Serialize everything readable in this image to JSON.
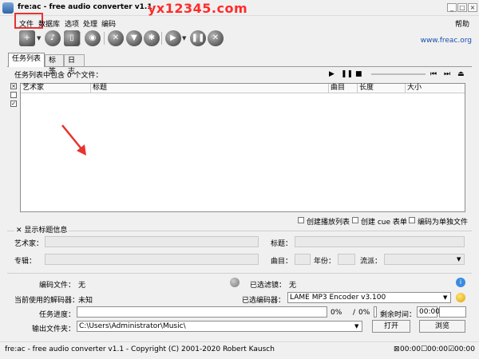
{
  "window": {
    "title": "fre:ac - free audio converter v1.1",
    "watermark": "yx12345.com"
  },
  "menu": {
    "file": "文件",
    "database": "数据库",
    "options": "选项",
    "process": "处理",
    "encode": "编码",
    "help": "帮助"
  },
  "toolbar": {
    "site": "www.freac.org"
  },
  "tabs": [
    "任务列表",
    "标签",
    "日志"
  ],
  "joblist": {
    "info": "任务列表中包含 0 个文件：",
    "columns": {
      "artist": "艺术家",
      "title": "标题",
      "track": "曲目",
      "length": "长度",
      "size": "大小"
    }
  },
  "options": {
    "create_playlist": "创建播放列表",
    "create_cue": "创建 cue 表单",
    "single_file": "编码为单独文件"
  },
  "info_panel": {
    "show_title_info": "显示标题信息",
    "artist": "艺术家：",
    "title": "标题：",
    "album": "专辑：",
    "track": "曲目：",
    "year": "年份：",
    "genre": "流派："
  },
  "encode": {
    "encoding_file_label": "编码文件：",
    "encoding_file_value": "无",
    "selected_filter_label": "已选滤镜：",
    "selected_filter_value": "无",
    "decoder_label": "当前使用的解码器：",
    "decoder_value": "未知",
    "encoder_label": "已选编码器：",
    "encoder_value": "LAME MP3 Encoder v3.100",
    "progress_label": "任务进度：",
    "progress_pct1": "0%",
    "progress_sep": "/",
    "progress_pct2": "0%",
    "remaining_label": "剩余时间：",
    "remaining_value": "00:00",
    "output_label": "输出文件夹：",
    "output_value": "C:\\Users\\Administrator\\Music\\",
    "open_button": "打开",
    "browse_button": "浏览"
  },
  "statusbar": {
    "text": "fre:ac - free audio converter v1.1 - Copyright (C) 2001-2020 Robert Kausch",
    "t1": "00:00",
    "t2": "00:00",
    "t3": "00:00"
  }
}
